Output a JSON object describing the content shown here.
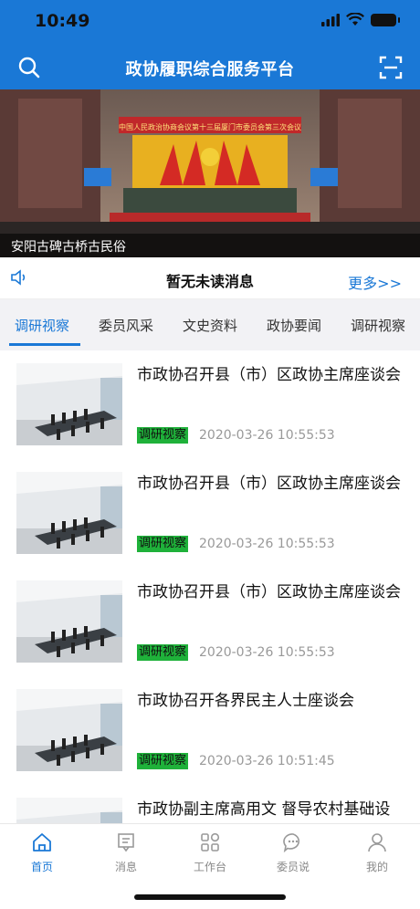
{
  "status": {
    "time": "10:49"
  },
  "header": {
    "title": "政协履职综合服务平台",
    "left_icon": "search-icon",
    "right_icon": "scan-icon",
    "color": "#1a78d6"
  },
  "banner": {
    "caption": "安阳古碑古桥古民俗",
    "slide_text": "中国人民政治协商会议第十三届厦门市委员会第三次会议"
  },
  "notice": {
    "text": "暂无未读消息",
    "more": "更多>>",
    "icon": "speaker-icon"
  },
  "tabs": [
    {
      "label": "调研视察",
      "active": true
    },
    {
      "label": "委员风采",
      "active": false
    },
    {
      "label": "文史资料",
      "active": false
    },
    {
      "label": "政协要闻",
      "active": false
    },
    {
      "label": "调研视察",
      "active": false
    }
  ],
  "news": [
    {
      "title": "市政协召开县（市）区政协主席座谈会",
      "tag": "调研视察",
      "date": "2020-03-26 10:55:53"
    },
    {
      "title": "市政协召开县（市）区政协主席座谈会",
      "tag": "调研视察",
      "date": "2020-03-26 10:55:53"
    },
    {
      "title": "市政协召开县（市）区政协主席座谈会",
      "tag": "调研视察",
      "date": "2020-03-26 10:55:53"
    },
    {
      "title": "市政协召开各界民主人士座谈会",
      "tag": "调研视察",
      "date": "2020-03-26 10:51:45"
    },
    {
      "title": "市政协副主席高用文 督导农村基础设",
      "tag": "",
      "date": ""
    }
  ],
  "tabbar": [
    {
      "label": "首页",
      "icon": "home-icon",
      "active": true
    },
    {
      "label": "消息",
      "icon": "message-icon",
      "active": false
    },
    {
      "label": "工作台",
      "icon": "workbench-icon",
      "active": false
    },
    {
      "label": "委员说",
      "icon": "chat-icon",
      "active": false
    },
    {
      "label": "我的",
      "icon": "person-icon",
      "active": false
    }
  ]
}
